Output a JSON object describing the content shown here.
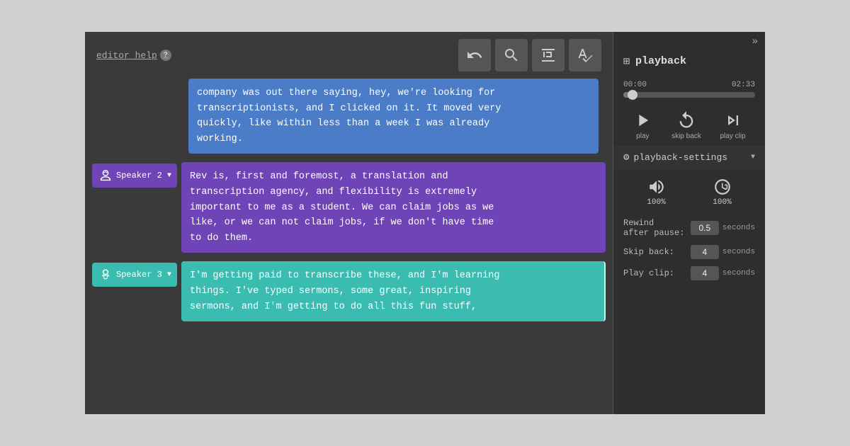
{
  "editor": {
    "help_label": "editor help",
    "help_icon": "?",
    "toolbar": {
      "undo_label": "undo",
      "search_label": "search",
      "timestamp_label": "timestamp",
      "spellcheck_label": "spellcheck"
    }
  },
  "segments": [
    {
      "id": "seg-top-partial",
      "type": "partial",
      "color": "blue",
      "text": "company was out there saying, hey, we're looking for\ntranscriptionists, and I clicked on it. It moved very\nquickly, like within less than a week I was already\nworking."
    },
    {
      "id": "seg-2",
      "type": "full",
      "color": "purple",
      "speaker": "Speaker 2",
      "text": "Rev is, first and foremost, a translation and\ntranscription agency, and flexibility  is extremely\nimportant to me as a student. We can claim jobs as we\nlike, or we can not claim jobs, if we don't have time\nto do them."
    },
    {
      "id": "seg-3",
      "type": "full",
      "color": "teal",
      "speaker": "Speaker 3",
      "text": "I'm getting paid to transcribe these, and I'm learning\nthings. I've typed sermons, some great, inspiring\nsermons, and I'm getting to do all this fun stuff,"
    }
  ],
  "playback": {
    "title": "playback",
    "time_current": "00:00",
    "time_total": "02:33",
    "progress_percent": 3,
    "controls": {
      "play_label": "play",
      "skip_back_label": "skip back",
      "play_clip_label": "play clip"
    },
    "settings": {
      "label": "playback-settings",
      "volume_pct": "100%",
      "speed_pct": "100%",
      "rewind_label": "Rewind\nafter pause:",
      "rewind_value": "0.5",
      "skip_back_label": "Skip back:",
      "skip_back_value": "4",
      "play_clip_label": "Play clip:",
      "play_clip_value": "4",
      "seconds_label": "seconds"
    }
  }
}
